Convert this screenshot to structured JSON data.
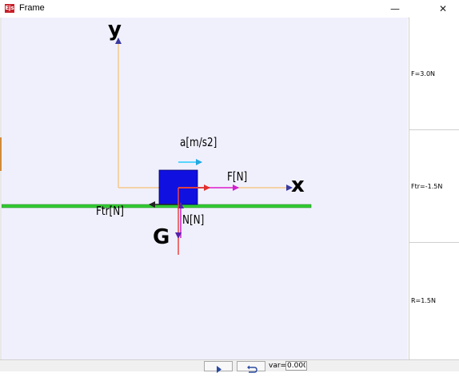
{
  "window": {
    "title": "Frame",
    "icon_text": "Ejs",
    "icon_name": "ejs-app-icon",
    "minimize_glyph": "—",
    "close_glyph": "✕"
  },
  "scene": {
    "y_axis_label": "y",
    "x_axis_label": "x",
    "gravity_label": "G",
    "acceleration_label": "a[m/s2]",
    "force_label": "F[N]",
    "friction_label": "Ftr[N]",
    "normal_label": "N[N]",
    "colors": {
      "background": "#f0f0fd",
      "axes": "#f5c88a",
      "ground": "#33cc33",
      "block": "#1010e0",
      "force_vector": "#e04040",
      "force_vector_alt": "#dd22dd",
      "normal_vector": "#cc22cc",
      "gravity_vector": "#ee4444",
      "acceleration_vector": "#22ccff",
      "friction_vector": "#222222"
    }
  },
  "readouts": {
    "force": "F=3.0N",
    "friction": "Ftr=-1.5N",
    "resultant": "R=1.5N"
  },
  "controls": {
    "play_icon": "play-icon",
    "reset_icon": "reset-icon",
    "var_label": "var=",
    "var_value": "0.000"
  }
}
